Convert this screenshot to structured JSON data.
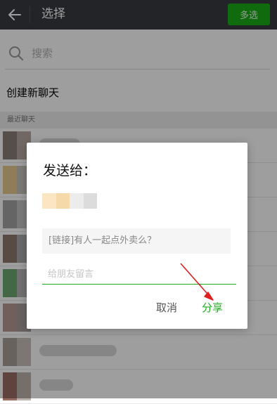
{
  "header": {
    "title": "选择",
    "multi_select_label": "多选"
  },
  "search": {
    "placeholder": "搜索"
  },
  "new_chat_label": "创建新聊天",
  "recent_section_title": "最近聊天",
  "dialog": {
    "title": "发送给：",
    "link_preview": "[链接]有人一起点外卖么？",
    "message_placeholder": "给朋友留言",
    "cancel_label": "取消",
    "share_label": "分享"
  },
  "colors": {
    "header_bg": "#393a3f",
    "accent_green": "#1aad19",
    "annotation_red": "#e02020"
  }
}
